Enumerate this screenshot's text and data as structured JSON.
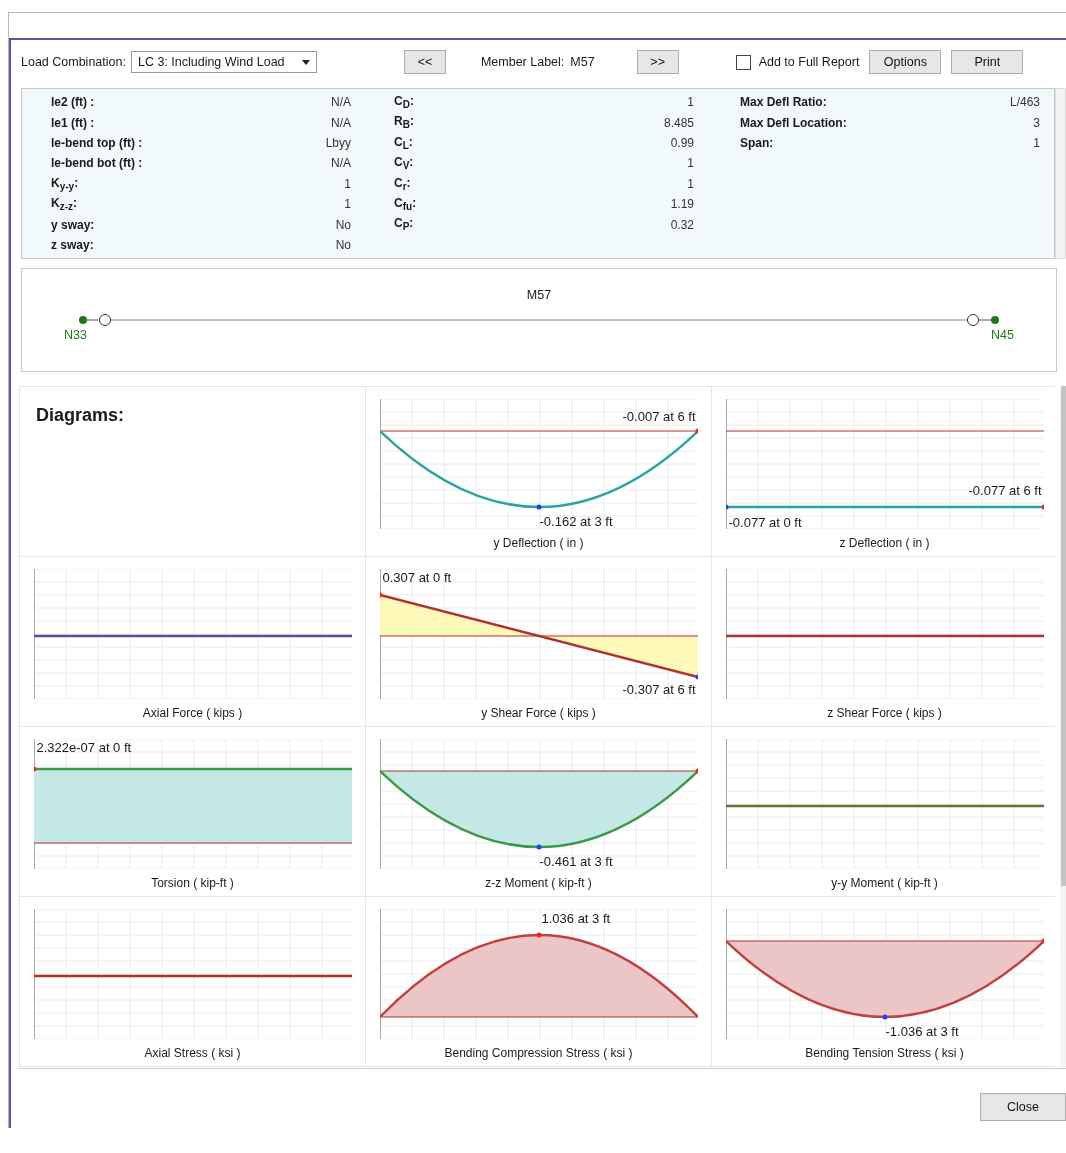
{
  "toolbar": {
    "load_combination_label": "Load Combination:",
    "load_combination": "LC 3: Including Wind Load",
    "prev_button": "<<",
    "member_label_caption": "Member Label:",
    "member_label": "M57",
    "next_button": ">>",
    "add_to_report": {
      "label": "Add to Full Report",
      "checked": false
    },
    "buttons": [
      "Options",
      "Print"
    ]
  },
  "properties": [
    [
      {
        "label": "le2 (ft) :",
        "value": "N/A"
      },
      {
        "label": "le1 (ft) :",
        "value": "N/A"
      },
      {
        "label": "le-bend top (ft) :",
        "value": "Lbyy"
      },
      {
        "label": "le-bend bot (ft) :",
        "value": "N/A"
      },
      {
        "label": "K$_{y-y}$:",
        "value": "1"
      },
      {
        "label": "K$_{z-z}$:",
        "value": "1"
      },
      {
        "label": "y sway:",
        "value": "No"
      },
      {
        "label": "z sway:",
        "value": "No"
      }
    ],
    [
      {
        "label": "C$_{D}$:",
        "value": "1"
      },
      {
        "label": "R$_{B}$:",
        "value": "8.485"
      },
      {
        "label": "C$_{L}$:",
        "value": "0.99"
      },
      {
        "label": "C$_{V}$:",
        "value": "1"
      },
      {
        "label": "C$_{r}$:",
        "value": "1"
      },
      {
        "label": "C$_{fu}$:",
        "value": "1.19"
      },
      {
        "label": "C$_{P}$:",
        "value": "0.32"
      }
    ],
    [
      {
        "label": "Max Defl Ratio:",
        "value": "L/463"
      },
      {
        "label": "Max Defl Location:",
        "value": "3"
      },
      {
        "label": "Span:",
        "value": "1"
      }
    ]
  ],
  "member": {
    "label": "M57",
    "start_node": "N33",
    "end_node": "N45"
  },
  "diagrams_heading": "Diagrams:",
  "diagrams": [
    {
      "title": "y Deflection  ( in )",
      "kind": "sag",
      "filled": false,
      "color": "#2aa3a3",
      "labels": [
        {
          "text": "-0.007 at 6 ft",
          "kind": "top-right"
        },
        {
          "text": "-0.162 at 3 ft",
          "kind": "bottom-center"
        }
      ]
    },
    {
      "title": "z Deflection  ( in )",
      "kind": "offset",
      "color": "#2aa3a3",
      "labels": [
        {
          "text": "-0.077 at 6 ft",
          "kind": "right-mid"
        },
        {
          "text": "-0.077 at 0 ft",
          "kind": "bottom-left"
        }
      ]
    },
    {
      "title": "Axial Force  ( kips )",
      "kind": "flat",
      "color": "#5050a0"
    },
    {
      "title": "y Shear Force  ( kips )",
      "kind": "slope",
      "filled": true,
      "color": "#b03030",
      "labels": [
        {
          "text": "0.307 at 0 ft",
          "kind": "top-left"
        },
        {
          "text": "-0.307 at 6 ft",
          "kind": "bottom-right"
        }
      ]
    },
    {
      "title": "z Shear Force  ( kips )",
      "kind": "flat",
      "color": "#b03030"
    },
    {
      "title": "Torsion  ( kip-ft )",
      "kind": "band",
      "filled": true,
      "color": "#3a9a4a",
      "labels": [
        {
          "text": "2.322e-07 at 0 ft",
          "kind": "top-left"
        }
      ]
    },
    {
      "title": "z-z Moment  ( kip-ft )",
      "kind": "sag",
      "filled": true,
      "color": "#3a9a4a",
      "labels": [
        {
          "text": "-0.461 at 3 ft",
          "kind": "bottom-center"
        }
      ]
    },
    {
      "title": "y-y Moment  ( kip-ft )",
      "kind": "flat",
      "color": "#6b6b3a"
    },
    {
      "title": "Axial Stress  ( ksi )",
      "kind": "flat",
      "color": "#b03030"
    },
    {
      "title": "Bending Compression Stress  ( ksi )",
      "kind": "hump",
      "filled": true,
      "color": "#c04040",
      "labels": [
        {
          "text": "1.036 at 3 ft",
          "kind": "top-center"
        }
      ]
    },
    {
      "title": "Bending Tension Stress  ( ksi )",
      "kind": "sag",
      "filled": true,
      "color": "#c04040",
      "labels": [
        {
          "text": "-1.036 at 3 ft",
          "kind": "bottom-center"
        }
      ]
    }
  ],
  "close_button": "Close"
}
